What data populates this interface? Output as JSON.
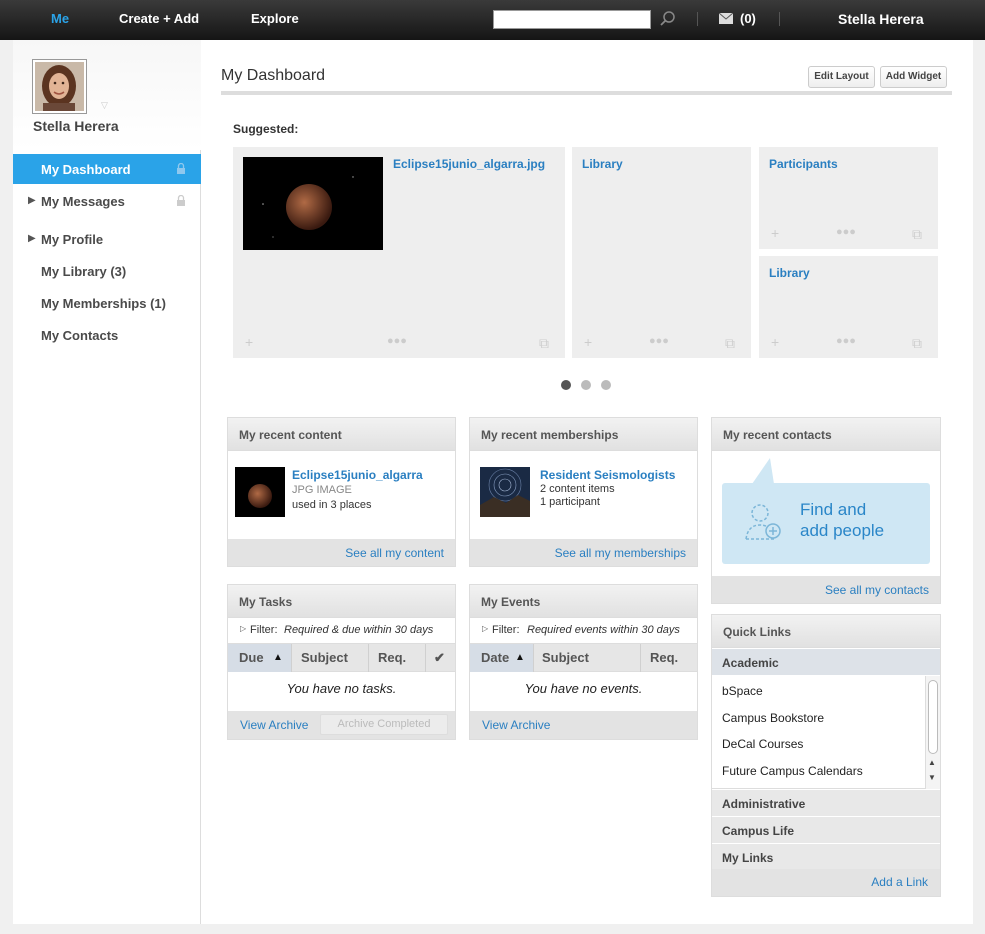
{
  "topbar": {
    "me": "Me",
    "create": "Create + Add",
    "explore": "Explore",
    "search_value": "",
    "mail_count": "(0)",
    "user": "Stella Herera"
  },
  "sidebar": {
    "name": "Stella Herera",
    "items": [
      {
        "label": "My Dashboard"
      },
      {
        "label": "My Messages"
      },
      {
        "label": "My Profile"
      },
      {
        "label": "My Library (3)"
      },
      {
        "label": "My Memberships (1)"
      },
      {
        "label": "My Contacts"
      }
    ]
  },
  "main": {
    "title": "My Dashboard",
    "edit_layout": "Edit Layout",
    "add_widget": "Add Widget",
    "suggested_label": "Suggested:",
    "tiles": [
      {
        "link": "Eclipse15junio_algarra.jpg"
      },
      {
        "link": "Library"
      },
      {
        "link": "Participants"
      },
      {
        "link": "Library"
      }
    ]
  },
  "recent_content": {
    "title": "My recent content",
    "item_title": "Eclipse15junio_algarra",
    "item_type": "JPG IMAGE",
    "item_used": "used in 3 places",
    "footer": "See all my content"
  },
  "recent_memberships": {
    "title": "My recent memberships",
    "item_title": "Resident Seismologists",
    "item_content": "2 content items",
    "item_participants": "1 participant",
    "footer": "See all my memberships"
  },
  "recent_contacts": {
    "title": "My recent contacts",
    "find_line1": "Find and",
    "find_line2": "add people",
    "footer": "See all my contacts"
  },
  "tasks": {
    "title": "My Tasks",
    "filter_prefix": "Filter:",
    "filter_value": "Required & due within 30 days",
    "col_due": "Due",
    "col_subject": "Subject",
    "col_req": "Req.",
    "empty": "You have no tasks.",
    "view_archive": "View Archive",
    "archive_completed": "Archive Completed"
  },
  "events": {
    "title": "My Events",
    "filter_prefix": "Filter:",
    "filter_value": "Required events within 30 days",
    "col_date": "Date",
    "col_subject": "Subject",
    "col_req": "Req.",
    "empty": "You have no events.",
    "view_archive": "View Archive"
  },
  "quick_links": {
    "title": "Quick Links",
    "sections": [
      "Academic",
      "Administrative",
      "Campus Life",
      "My Links"
    ],
    "academic_items": [
      "bSpace",
      "Campus Bookstore",
      "DeCal Courses",
      "Future Campus Calendars"
    ],
    "add_link": "Add a Link"
  },
  "colors": {
    "accent": "#2aa3e8",
    "link": "#2a7fc1",
    "topbar": "#1c1c1c"
  }
}
